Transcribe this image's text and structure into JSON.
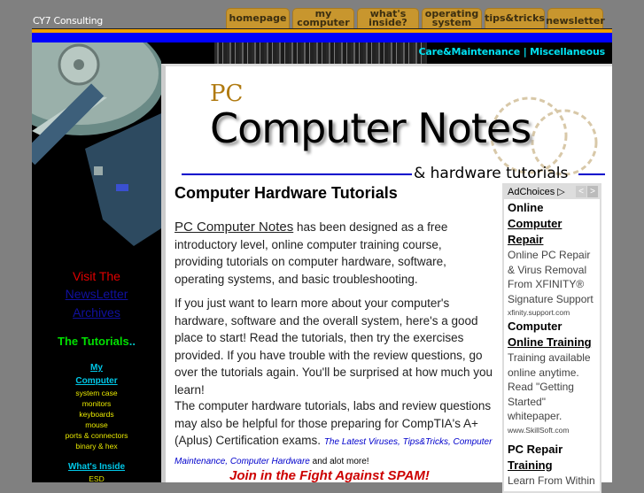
{
  "site": {
    "name": "CY7 Consulting"
  },
  "nav": {
    "tabs": [
      {
        "lines": [
          "homepage"
        ]
      },
      {
        "lines": [
          "my",
          "computer"
        ]
      },
      {
        "lines": [
          "what's",
          "inside?"
        ]
      },
      {
        "lines": [
          "operating",
          "system"
        ]
      },
      {
        "lines": [
          "tips&tricks"
        ]
      },
      {
        "lines": [
          "newsletter"
        ]
      }
    ],
    "subnav": {
      "item1": "Care&Maintenance",
      "separator": "|",
      "item2": "Miscellaneous"
    }
  },
  "logo": {
    "pc": "PC",
    "main": "Computer Notes",
    "sub": "& hardware tutorials"
  },
  "main": {
    "title": "Computer Hardware Tutorials",
    "p1_link": "PC Computer Notes",
    "p1_text": " has been designed as a free introductory level, online computer training course, providing tutorials on computer hardware, software, operating systems, and basic troubleshooting.",
    "p2": "If you just want to learn more about your computer's hardware, software and the overall system, here's a good place to start! Read the tutorials, then try the exercises provided. If you have trouble with the review questions, go over the tutorials again. You'll be surprised at how much you learn!",
    "p3_text": "The computer hardware tutorials, labs and review questions may also be helpful for those preparing for CompTIA's A+ (Aplus) Certification exams. ",
    "p3_links": "The Latest Viruses, Tips&Tricks, Computer Maintenance, Computer Hardware",
    "p3_tail": " and alot more!",
    "spam": "Join in the Fight Against SPAM!"
  },
  "ad": {
    "label": "AdChoices",
    "prev": "<",
    "next": ">",
    "items": [
      {
        "title1": "Online",
        "title2": "Computer Repair",
        "text": "Online PC Repair & Virus Removal From XFINITY® Signature Support",
        "url": "xfinity.support.com"
      },
      {
        "title1": "Computer",
        "title2": "Online Training",
        "text": "Training available online anytime. Read \"Getting Started\" whitepaper.",
        "url": "www.SkillSoft.com"
      },
      {
        "title1": "PC Repair",
        "title2": "Training",
        "text": "Learn From Within"
      }
    ]
  },
  "sidebar": {
    "visit": "Visit The",
    "newsletter1": "NewsLetter",
    "newsletter2": "Archives",
    "tutorials": "The Tutorials",
    "tutorials_dots": "..",
    "cat1a": "My",
    "cat1b": "Computer",
    "cat1_items": [
      "system case",
      "monitors",
      "keyboards",
      "mouse",
      "ports & connectors",
      "binary & hex"
    ],
    "cat2": "What's Inside",
    "cat2_items": [
      "ESD"
    ]
  }
}
